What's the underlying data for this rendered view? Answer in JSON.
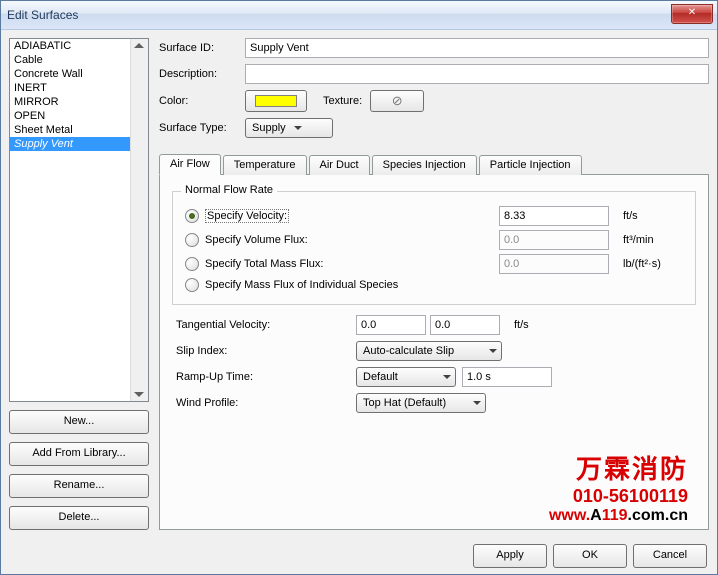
{
  "title": "Edit Surfaces",
  "list": [
    "ADIABATIC",
    "Cable",
    "Concrete Wall",
    "INERT",
    "MIRROR",
    "OPEN",
    "Sheet Metal",
    "Supply Vent"
  ],
  "selected": "Supply Vent",
  "leftButtons": {
    "new": "New...",
    "addLib": "Add From Library...",
    "rename": "Rename...",
    "delete": "Delete..."
  },
  "form": {
    "surfaceIdLabel": "Surface ID:",
    "surfaceId": "Supply Vent",
    "descLabel": "Description:",
    "desc": "",
    "colorLabel": "Color:",
    "colorHex": "#ffff00",
    "textureLabel": "Texture:",
    "surfaceTypeLabel": "Surface Type:",
    "surfaceType": "Supply"
  },
  "tabs": [
    "Air Flow",
    "Temperature",
    "Air Duct",
    "Species Injection",
    "Particle Injection"
  ],
  "airflow": {
    "groupTitle": "Normal Flow Rate",
    "r1": "Specify Velocity:",
    "r1v": "8.33",
    "r1u": "ft/s",
    "r2": "Specify Volume Flux:",
    "r2v": "0.0",
    "r2u": "ft³/min",
    "r3": "Specify Total Mass Flux:",
    "r3v": "0.0",
    "r3u": "lb/(ft²·s)",
    "r4": "Specify Mass Flux of Individual Species",
    "tangLabel": "Tangential Velocity:",
    "tang1": "0.0",
    "tang2": "0.0",
    "tangU": "ft/s",
    "slipLabel": "Slip Index:",
    "slipVal": "Auto-calculate Slip",
    "rampLabel": "Ramp-Up Time:",
    "rampSel": "Default",
    "rampVal": "1.0 s",
    "windLabel": "Wind Profile:",
    "windSel": "Top Hat (Default)"
  },
  "footer": {
    "apply": "Apply",
    "ok": "OK",
    "cancel": "Cancel"
  },
  "watermark": {
    "l1": "万霖消防",
    "l2": "010-56100119"
  }
}
